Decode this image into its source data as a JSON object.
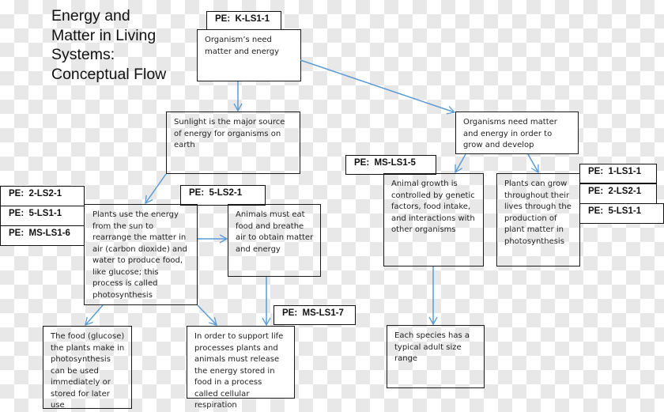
{
  "title": "Energy and Matter in Living Systems: Conceptual Flow",
  "title_lines": [
    "Energy and",
    "Matter in Living",
    "Systems:",
    "Conceptual Flow"
  ],
  "colors": {
    "arrow": "#5b9bd5",
    "border": "#1a1a1a"
  },
  "nodes": {
    "organisms_need": {
      "text": "Organism’s need matter and energy",
      "pe": [
        "PE:  K-LS1-1"
      ]
    },
    "sunlight": {
      "text": "Sunlight is the major source of energy for organisms on earth"
    },
    "organisms_grow": {
      "text": "Organisms need matter and energy in order to grow and develop"
    },
    "plants_use": {
      "text": "Plants use the energy from the sun to rearrange the matter in air (carbon dioxide) and water to produce food, like glucose; this process is called photosynthesis",
      "pe": [
        "PE:  2-LS2-1",
        "PE:  5-LS1-1",
        "PE:  MS-LS1-6"
      ]
    },
    "animals_eat": {
      "text": "Animals must eat food and breathe air to obtain matter and energy",
      "pe": [
        "PE:  5-LS2-1"
      ]
    },
    "animal_growth": {
      "text": "Animal growth is controlled by genetic factors, food intake, and interactions with other organisms",
      "pe": [
        "PE:  MS-LS1-5"
      ]
    },
    "plants_grow": {
      "text": "Plants can grow throughout their lives through the production of plant matter in photosynthesis",
      "pe": [
        "PE:  1-LS1-1",
        "PE:  2-LS2-1",
        "PE:  5-LS1-1"
      ]
    },
    "food_glucose": {
      "text": "The food (glucose) the plants make in photosynthesis can be used immediately or stored for later use"
    },
    "respiration": {
      "text": "In order to support life processes plants and animals must release the energy stored in food in a process called cellular respiration",
      "pe": [
        "PE:  MS-LS1-7"
      ]
    },
    "species_size": {
      "text": "Each species has a typical adult size range"
    }
  },
  "edges": [
    {
      "from": "organisms_need",
      "to": "sunlight"
    },
    {
      "from": "organisms_need",
      "to": "organisms_grow"
    },
    {
      "from": "sunlight",
      "to": "plants_use"
    },
    {
      "from": "plants_use",
      "to": "animals_eat"
    },
    {
      "from": "plants_use",
      "to": "food_glucose"
    },
    {
      "from": "plants_use",
      "to": "respiration"
    },
    {
      "from": "animals_eat",
      "to": "respiration"
    },
    {
      "from": "organisms_grow",
      "to": "animal_growth"
    },
    {
      "from": "organisms_grow",
      "to": "plants_grow"
    },
    {
      "from": "animal_growth",
      "to": "species_size"
    }
  ]
}
